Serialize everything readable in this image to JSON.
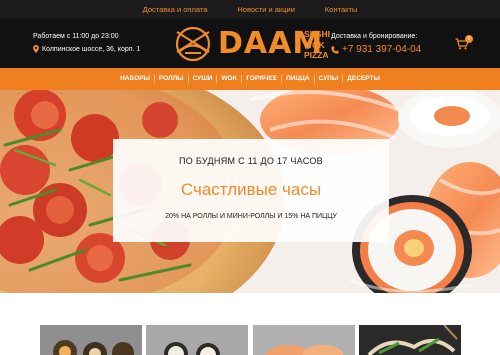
{
  "topbar": {
    "links": [
      "Доставка и оплата",
      "Новости и акции",
      "Контакты"
    ]
  },
  "header": {
    "hours": "Работаем с 11:00 до 23:00",
    "address": "Колпинское шоссе, 36, корп. 1",
    "logo": {
      "word": "DAAM",
      "sub": [
        "SUSHI",
        "WOK",
        "PIZZA"
      ]
    },
    "delivery_title": "Доставка и бронирование:",
    "phone": "+7 931 397-04-04",
    "cart_count": "0"
  },
  "nav": {
    "items": [
      "НАБОРЫ",
      "РОЛЛЫ",
      "СУШИ",
      "WOK",
      "ГОРЯЧЕЕ",
      "ПИЦЦА",
      "СУПЫ",
      "ДЕСЕРТЫ"
    ]
  },
  "hero": {
    "kicker": "ПО БУДНЯМ С 11 ДО 17 ЧАСОВ",
    "title": "Счастливые часы",
    "text": "20% НА РОЛЛЫ И МИНИ-РОЛЛЫ И 15% НА ПИЦЦУ"
  },
  "colors": {
    "accent": "#f28c28",
    "nav": "#f07f1f",
    "dark": "#111111"
  },
  "icons": [
    "map-pin-icon",
    "phone-icon",
    "cart-icon",
    "logo-chopsticks-icon"
  ]
}
